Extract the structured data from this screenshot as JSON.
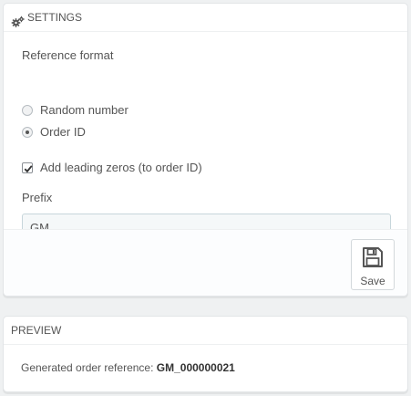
{
  "settings": {
    "heading": "Settings",
    "reference_format_label": "Reference format",
    "options": [
      {
        "label": "Random number",
        "selected": false
      },
      {
        "label": "Order ID",
        "selected": true
      }
    ],
    "leading_zeros": {
      "label": "Add leading zeros (to order ID)",
      "checked": true
    },
    "prefix_label": "Prefix",
    "prefix_value": "GM_",
    "save_label": "Save"
  },
  "preview": {
    "heading": "Preview",
    "generated_label": "Generated order reference:",
    "generated_value": "GM_000000021"
  },
  "icons": {
    "settings_heading": "cogs-icon",
    "save": "floppy-disk-icon"
  }
}
